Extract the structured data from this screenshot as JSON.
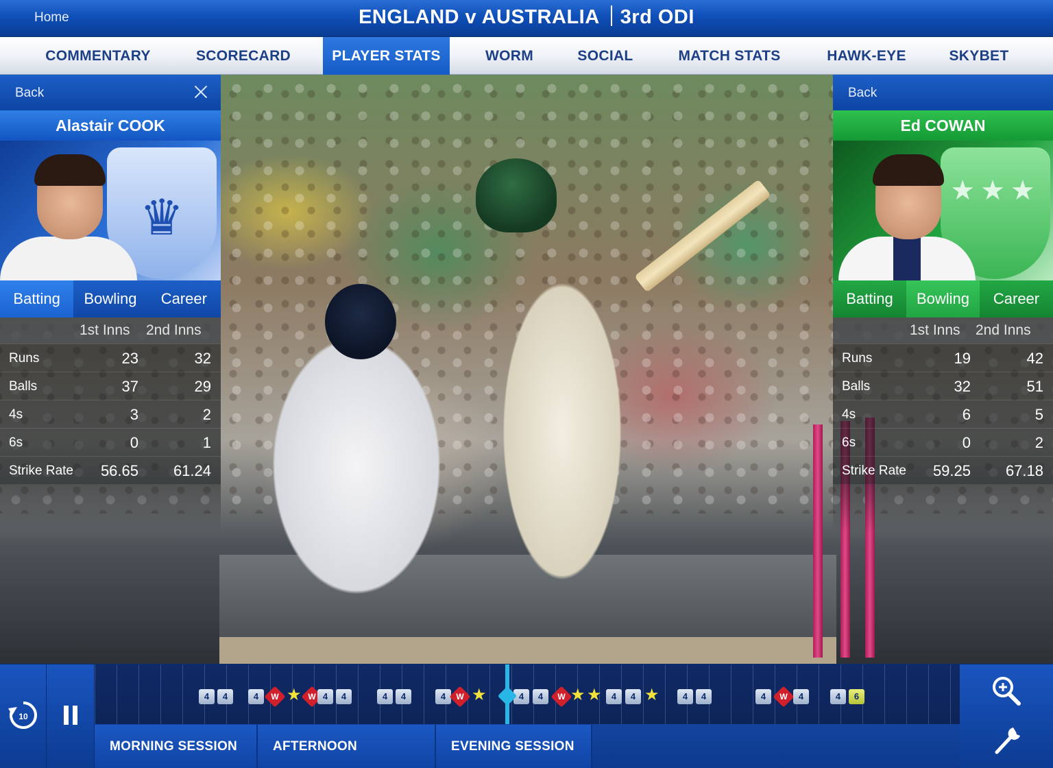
{
  "header": {
    "home_label": "Home",
    "title_left": "ENGLAND v AUSTRALIA",
    "title_right": "3rd ODI"
  },
  "tabs": [
    {
      "label": "COMMENTARY"
    },
    {
      "label": "SCORECARD"
    },
    {
      "label": "PLAYER STATS",
      "active": true
    },
    {
      "label": "WORM"
    },
    {
      "label": "SOCIAL"
    },
    {
      "label": "MATCH STATS"
    },
    {
      "label": "HAWK-EYE"
    },
    {
      "label": "SKYBET"
    }
  ],
  "left_player": {
    "back_label": "Back",
    "name": "Alastair COOK",
    "team_color": "#1355c2",
    "subtabs": [
      "Batting",
      "Bowling",
      "Career"
    ],
    "active_subtab": "Batting",
    "innings_headers": [
      "1st Inns",
      "2nd Inns"
    ],
    "stats": [
      {
        "label": "Runs",
        "inns1": "23",
        "inns2": "32"
      },
      {
        "label": "Balls",
        "inns1": "37",
        "inns2": "29"
      },
      {
        "label": "4s",
        "inns1": "3",
        "inns2": "2"
      },
      {
        "label": "6s",
        "inns1": "0",
        "inns2": "1"
      },
      {
        "label": "Strike Rate",
        "inns1": "56.65",
        "inns2": "61.24"
      }
    ]
  },
  "right_player": {
    "back_label": "Back",
    "name": "Ed COWAN",
    "team_color": "#159a36",
    "subtabs": [
      "Batting",
      "Bowling",
      "Career"
    ],
    "active_subtab": "Bowling",
    "innings_headers": [
      "1st Inns",
      "2nd Inns"
    ],
    "stats": [
      {
        "label": "Runs",
        "inns1": "19",
        "inns2": "42"
      },
      {
        "label": "Balls",
        "inns1": "32",
        "inns2": "51"
      },
      {
        "label": "4s",
        "inns1": "6",
        "inns2": "5"
      },
      {
        "label": "6s",
        "inns1": "0",
        "inns2": "2"
      },
      {
        "label": "Strike Rate",
        "inns1": "59.25",
        "inns2": "67.18"
      }
    ]
  },
  "controls": {
    "replay_icon": "replay-10-icon",
    "replay_seconds": "10",
    "pause_icon": "pause-icon",
    "zoom_icon": "zoom-in-icon",
    "settings_icon": "wrench-icon"
  },
  "timeline": {
    "four_label": "4",
    "six_label": "6",
    "wicket_label": "W",
    "events": [
      "4",
      "4",
      "4",
      "W",
      "star",
      "W",
      "4",
      "4",
      "4",
      "4",
      "4",
      "W",
      "star",
      "4",
      "4",
      "W",
      "star",
      "star",
      "4",
      "4",
      "star",
      "4",
      "4",
      "4",
      "W",
      "4",
      "4",
      "6"
    ]
  },
  "sessions": [
    {
      "label": "MORNING SESSION"
    },
    {
      "label": "AFTERNOON SESSION"
    },
    {
      "label": "EVENING SESSION"
    }
  ]
}
